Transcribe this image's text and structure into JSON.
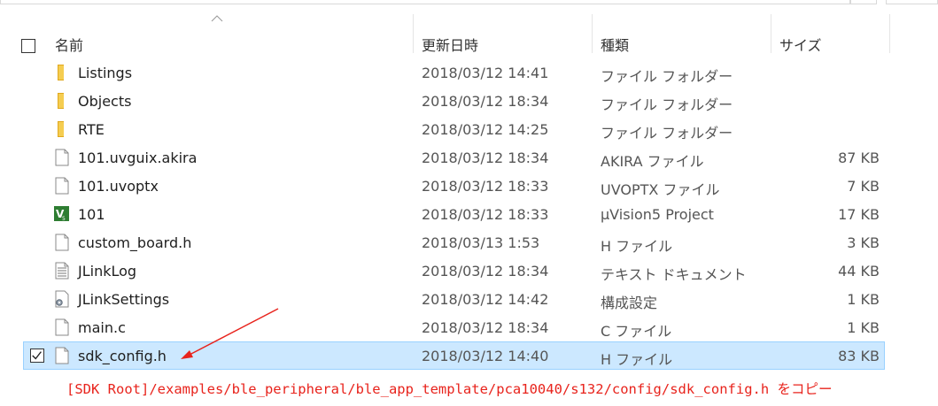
{
  "header": {
    "columns": [
      {
        "key": "name",
        "label": "名前"
      },
      {
        "key": "date",
        "label": "更新日時"
      },
      {
        "key": "type",
        "label": "種類"
      },
      {
        "key": "size",
        "label": "サイズ"
      }
    ]
  },
  "files": [
    {
      "name": "Listings",
      "date": "2018/03/12 14:41",
      "type": "ファイル フォルダー",
      "size": "",
      "icon": "folder-icon"
    },
    {
      "name": "Objects",
      "date": "2018/03/12 18:34",
      "type": "ファイル フォルダー",
      "size": "",
      "icon": "folder-icon"
    },
    {
      "name": "RTE",
      "date": "2018/03/12 14:25",
      "type": "ファイル フォルダー",
      "size": "",
      "icon": "folder-icon"
    },
    {
      "name": "101.uvguix.akira",
      "date": "2018/03/12 18:34",
      "type": "AKIRA ファイル",
      "size": "87 KB",
      "icon": "file-icon"
    },
    {
      "name": "101.uvoptx",
      "date": "2018/03/12 18:33",
      "type": "UVOPTX ファイル",
      "size": "7 KB",
      "icon": "file-icon"
    },
    {
      "name": "101",
      "date": "2018/03/12 18:33",
      "type": "µVision5 Project",
      "size": "17 KB",
      "icon": "uvision-project-icon"
    },
    {
      "name": "custom_board.h",
      "date": "2018/03/13 1:53",
      "type": "H ファイル",
      "size": "3 KB",
      "icon": "file-icon"
    },
    {
      "name": "JLinkLog",
      "date": "2018/03/12 18:34",
      "type": "テキスト ドキュメント",
      "size": "44 KB",
      "icon": "text-document-icon"
    },
    {
      "name": "JLinkSettings",
      "date": "2018/03/12 14:42",
      "type": "構成設定",
      "size": "1 KB",
      "icon": "settings-file-icon"
    },
    {
      "name": "main.c",
      "date": "2018/03/12 18:34",
      "type": "C ファイル",
      "size": "1 KB",
      "icon": "file-icon"
    },
    {
      "name": "sdk_config.h",
      "date": "2018/03/12 14:40",
      "type": "H ファイル",
      "size": "83 KB",
      "icon": "file-icon",
      "selected": true
    }
  ],
  "annotation": {
    "text": "[SDK Root]/examples/ble_peripheral/ble_app_template/pca10040/s132/config/sdk_config.h をコピー",
    "color": "#e8231c"
  },
  "colors": {
    "selection_bg": "#cce8ff",
    "selection_border": "#99d1ff",
    "folder": "#f2c94c",
    "accent_red": "#e8231c"
  }
}
